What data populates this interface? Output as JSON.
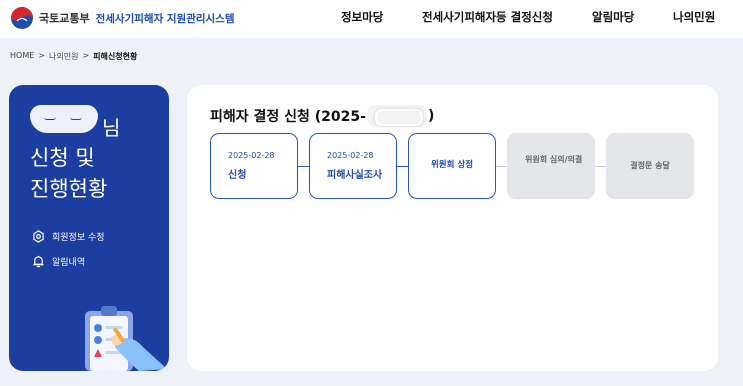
{
  "header": {
    "ministry": "국토교통부",
    "system": "전세사기피해자 지원관리시스템",
    "nav": [
      "정보마당",
      "전세사기피해자등 결정신청",
      "알림마당",
      "나의민원"
    ]
  },
  "breadcrumb": [
    "HOME",
    ">",
    "나의민원",
    ">",
    "피해신청현황"
  ],
  "sidebar": {
    "name_suffix": "님",
    "title_line1": "신청 및",
    "title_line2": "진행현황",
    "menu": [
      "회원정보 수정",
      "알림내역"
    ]
  },
  "panel": {
    "title_prefix": "피해자 결정 신청 (2025-",
    "title_suffix": ")",
    "steps": [
      {
        "date": "2025-02-28",
        "label": "신청",
        "status": "done"
      },
      {
        "date": "2025-02-28",
        "label": "피해사실조사",
        "status": "done"
      },
      {
        "date": "",
        "label": "위원회 상정",
        "status": "current"
      },
      {
        "date": "",
        "label": "위원회 심의/의결",
        "status": "pending"
      },
      {
        "date": "",
        "label": "결정문 송달",
        "status": "pending"
      }
    ]
  },
  "colors": {
    "accent": "#1b3ea0",
    "link": "#2148b5",
    "pending": "#e4e6ea",
    "page_bg": "#eef1f8"
  },
  "icons": [
    "government-logo-icon",
    "settings-icon",
    "bell-icon",
    "clipboard-illustration"
  ]
}
